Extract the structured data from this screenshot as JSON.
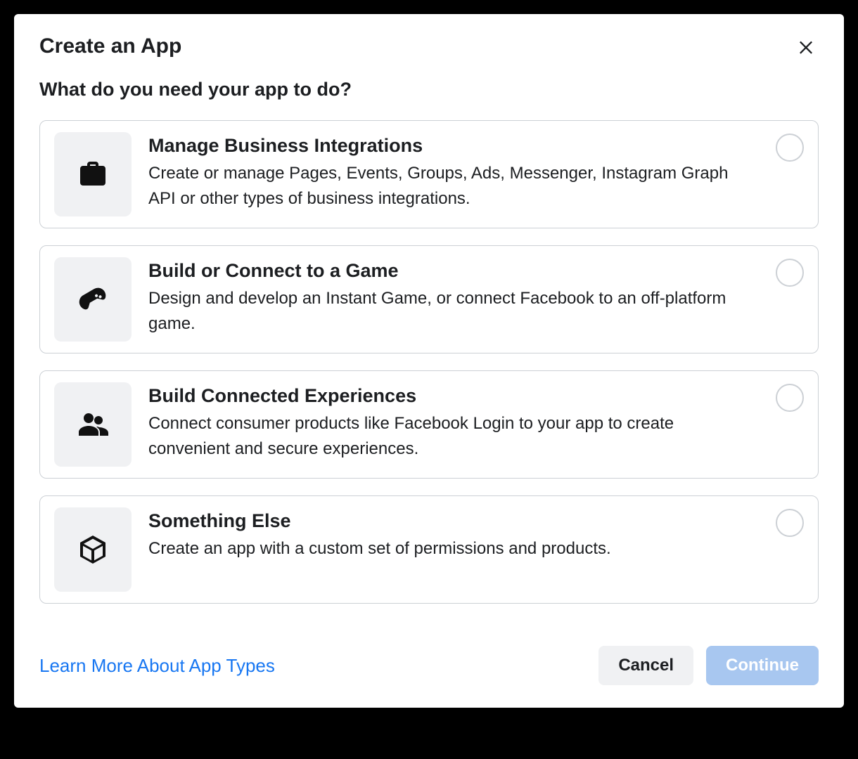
{
  "dialog": {
    "title": "Create an App",
    "subtitle": "What do you need your app to do?"
  },
  "options": [
    {
      "icon": "briefcase-icon",
      "title": "Manage Business Integrations",
      "desc": "Create or manage Pages, Events, Groups, Ads, Messenger, Instagram Graph API or other types of business integrations."
    },
    {
      "icon": "gamepad-icon",
      "title": "Build or Connect to a Game",
      "desc": "Design and develop an Instant Game, or connect Facebook to an off-platform game."
    },
    {
      "icon": "people-icon",
      "title": "Build Connected Experiences",
      "desc": "Connect consumer products like Facebook Login to your app to create convenient and secure experiences."
    },
    {
      "icon": "cube-icon",
      "title": "Something Else",
      "desc": "Create an app with a custom set of permissions and products."
    }
  ],
  "footer": {
    "learn_link": "Learn More About App Types",
    "cancel": "Cancel",
    "continue": "Continue"
  }
}
